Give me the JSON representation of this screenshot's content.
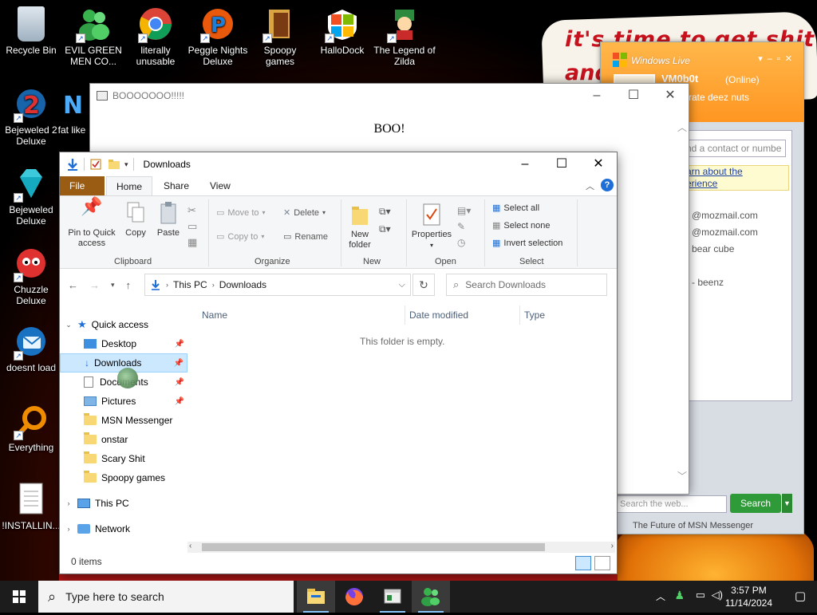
{
  "desktop": {
    "wallpaper_text": [
      "it's time to get shit",
      "and"
    ],
    "icons": [
      {
        "label": "Recycle Bin",
        "icon": "recycle-bin-icon"
      },
      {
        "label": "EVIL GREEN MEN CO...",
        "icon": "msn-men-icon"
      },
      {
        "label": "literally unusable",
        "icon": "chrome-icon"
      },
      {
        "label": "Peggle Nights Deluxe",
        "icon": "peggle-icon"
      },
      {
        "label": "Spoopy games",
        "icon": "folder-icon"
      },
      {
        "label": "HalloDock",
        "icon": "windows-logo-icon"
      },
      {
        "label": "The Legend of Zilda",
        "icon": "zilda-icon"
      },
      {
        "label": "Bejeweled 2 Deluxe",
        "icon": "bejeweled2-icon"
      },
      {
        "label": "fat like",
        "icon": "app-icon"
      },
      {
        "label": "Bejeweled Deluxe",
        "icon": "diamond-icon"
      },
      {
        "label": "Chuzzle Deluxe",
        "icon": "chuzzle-icon"
      },
      {
        "label": "doesnt load",
        "icon": "thunderbird-icon"
      },
      {
        "label": "Everything",
        "icon": "search-ring-icon"
      },
      {
        "label": "!INSTALLIN...",
        "icon": "text-file-icon"
      }
    ]
  },
  "boo_window": {
    "title": "BOOOOOOO!!!!!",
    "body_text": "BOO!"
  },
  "messenger": {
    "app_title": "Windows Live",
    "username": "VM0b0t",
    "status": "(Online)",
    "personal_message": "rate deez nuts",
    "add_contact_placeholder": "nd a contact or numbe",
    "info_link": [
      "arn about the",
      "erience"
    ],
    "contacts": [
      "@mozmail.com",
      "@mozmail.com",
      "bear cube",
      "- beenz"
    ],
    "search_placeholder": "Search the web...",
    "search_button": "Search",
    "footer": "The Future of MSN Messenger"
  },
  "explorer": {
    "title": "Downloads",
    "tabs": [
      "File",
      "Home",
      "Share",
      "View"
    ],
    "ribbon": {
      "clipboard": {
        "pin": "Pin to Quick access",
        "copy": "Copy",
        "paste": "Paste",
        "group": "Clipboard"
      },
      "organize": {
        "move_to": "Move to",
        "copy_to": "Copy to",
        "delete": "Delete",
        "rename": "Rename",
        "group": "Organize"
      },
      "new": {
        "new_folder": "New folder",
        "group": "New"
      },
      "open": {
        "properties": "Properties",
        "group": "Open"
      },
      "select": {
        "select_all": "Select all",
        "select_none": "Select none",
        "invert": "Invert selection",
        "group": "Select"
      }
    },
    "address": {
      "root": "This PC",
      "current": "Downloads"
    },
    "search_placeholder": "Search Downloads",
    "columns": [
      "Name",
      "Date modified",
      "Type"
    ],
    "empty_message": "This folder is empty.",
    "nav_tree": {
      "quick_access": "Quick access",
      "items": [
        "Desktop",
        "Downloads",
        "Documents",
        "Pictures",
        "MSN Messenger",
        "onstar",
        "Scary Shit",
        "Spoopy games"
      ],
      "this_pc": "This PC",
      "network": "Network"
    },
    "status": "0 items"
  },
  "taskbar": {
    "search_placeholder": "Type here to search",
    "time": "3:57 PM",
    "date": "11/14/2024"
  }
}
